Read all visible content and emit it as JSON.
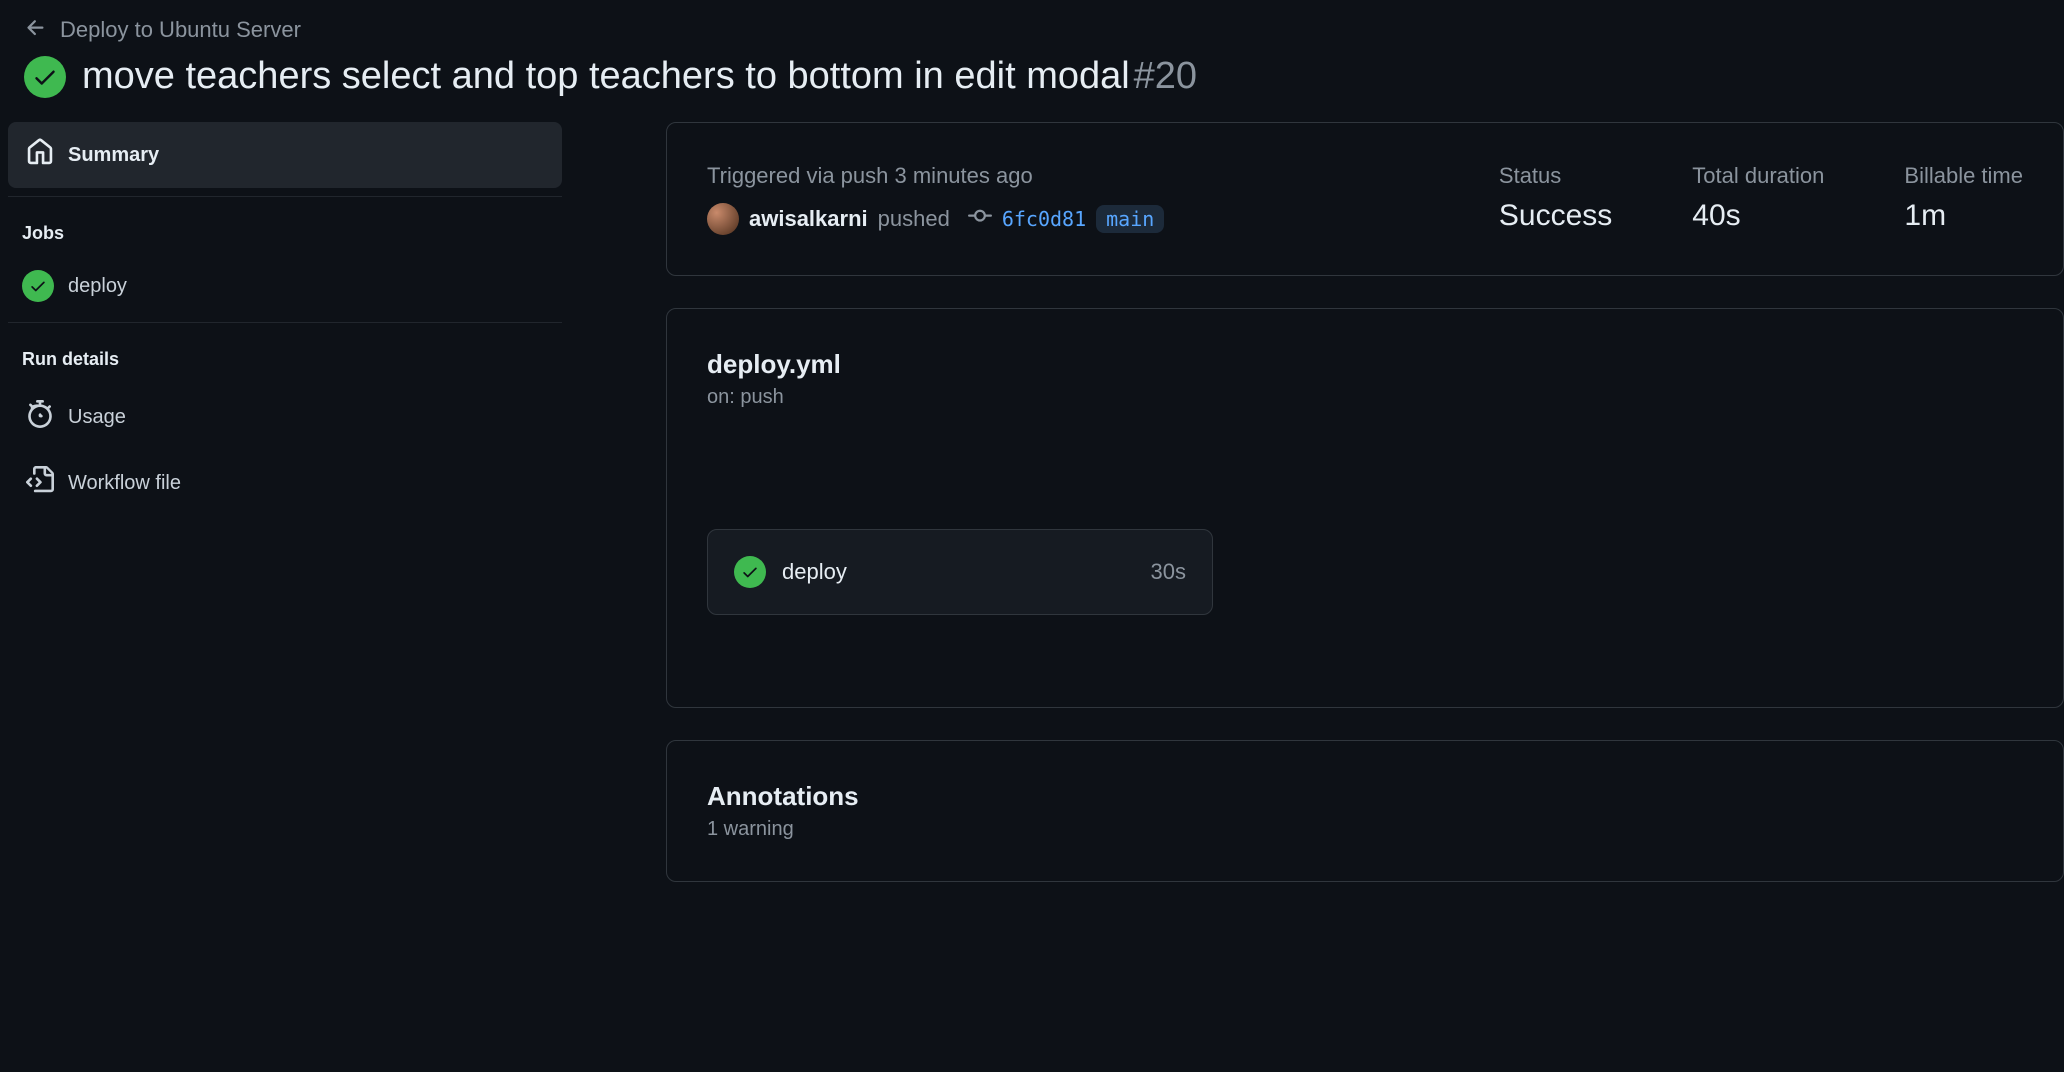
{
  "breadcrumb": {
    "text": "Deploy to Ubuntu Server"
  },
  "run": {
    "title": "move teachers select and top teachers to bottom in edit modal",
    "number": "#20"
  },
  "sidebar": {
    "summary": "Summary",
    "jobs_header": "Jobs",
    "jobs": [
      {
        "name": "deploy"
      }
    ],
    "run_details_header": "Run details",
    "usage": "Usage",
    "workflow_file": "Workflow file"
  },
  "trigger": {
    "text": "Triggered via push 3 minutes ago",
    "author": "awisalkarni",
    "action": "pushed",
    "sha": "6fc0d81",
    "branch": "main"
  },
  "stats": {
    "status_label": "Status",
    "status_value": "Success",
    "duration_label": "Total duration",
    "duration_value": "40s",
    "billable_label": "Billable time",
    "billable_value": "1m"
  },
  "workflow": {
    "title": "deploy.yml",
    "subtitle": "on: push",
    "job_name": "deploy",
    "job_duration": "30s"
  },
  "annotations": {
    "title": "Annotations",
    "subtitle": "1 warning"
  }
}
